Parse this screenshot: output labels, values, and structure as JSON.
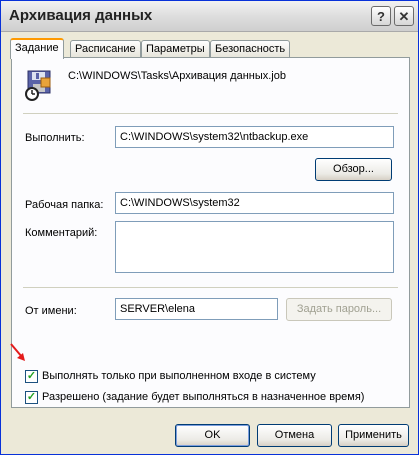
{
  "window": {
    "title": "Архивация данных",
    "help_glyph": "?",
    "close_glyph": "✕"
  },
  "tabs": [
    {
      "label": "Задание"
    },
    {
      "label": "Расписание"
    },
    {
      "label": "Параметры"
    },
    {
      "label": "Безопасность"
    }
  ],
  "task": {
    "path": "C:\\WINDOWS\\Tasks\\Архивация данных.job",
    "run_label": "Выполнить:",
    "run_value": "C:\\WINDOWS\\system32\\ntbackup.exe",
    "browse_label": "Обзор...",
    "workdir_label": "Рабочая папка:",
    "workdir_value": "C:\\WINDOWS\\system32",
    "comment_label": "Комментарий:",
    "comment_value": "",
    "runas_label": "От имени:",
    "runas_value": "SERVER\\elena",
    "set_password_label": "Задать пароль..."
  },
  "options": {
    "logged_on_label": "Выполнять только при выполненном входе в систему",
    "logged_on_checked": true,
    "enabled_label": "Разрешено (задание будет выполняться в назначенное время)",
    "enabled_checked": true,
    "check_glyph": "✓"
  },
  "footer": {
    "ok_label": "OK",
    "cancel_label": "Отмена",
    "apply_label": "Применить"
  },
  "colors": {
    "accent_red": "#e41b1b",
    "tab_highlight": "#ff9a00",
    "title_border": "#0831d9"
  }
}
